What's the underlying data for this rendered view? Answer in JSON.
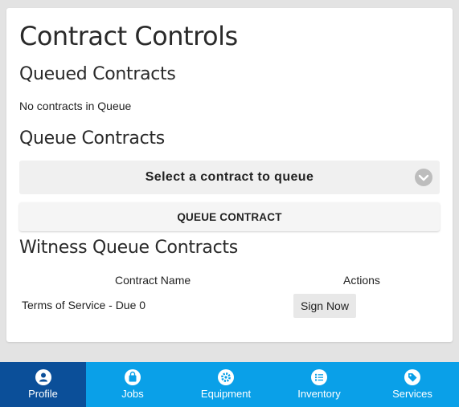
{
  "page": {
    "title": "Contract Controls",
    "queued": {
      "heading": "Queued Contracts",
      "empty_text": "No contracts in Queue"
    },
    "queue": {
      "heading": "Queue Contracts",
      "select_label": "Select a contract to queue",
      "button_label": "QUEUE CONTRACT"
    },
    "witness": {
      "heading": "Witness Queue Contracts",
      "col_name": "Contract Name",
      "col_actions": "Actions",
      "rows": [
        {
          "name": "Terms of Service - Due 0",
          "action": "Sign Now"
        }
      ]
    }
  },
  "nav": {
    "items": [
      {
        "label": "Profile",
        "icon": "person-icon",
        "active": true
      },
      {
        "label": "Jobs",
        "icon": "bag-icon",
        "active": false
      },
      {
        "label": "Equipment",
        "icon": "gear-icon",
        "active": false
      },
      {
        "label": "Inventory",
        "icon": "list-icon",
        "active": false
      },
      {
        "label": "Services",
        "icon": "tag-icon",
        "active": false
      }
    ]
  },
  "colors": {
    "nav_bg": "#0aa0e8",
    "nav_active": "#0b4f99",
    "card_bg": "#ffffff",
    "page_bg": "#e3e3e3"
  }
}
